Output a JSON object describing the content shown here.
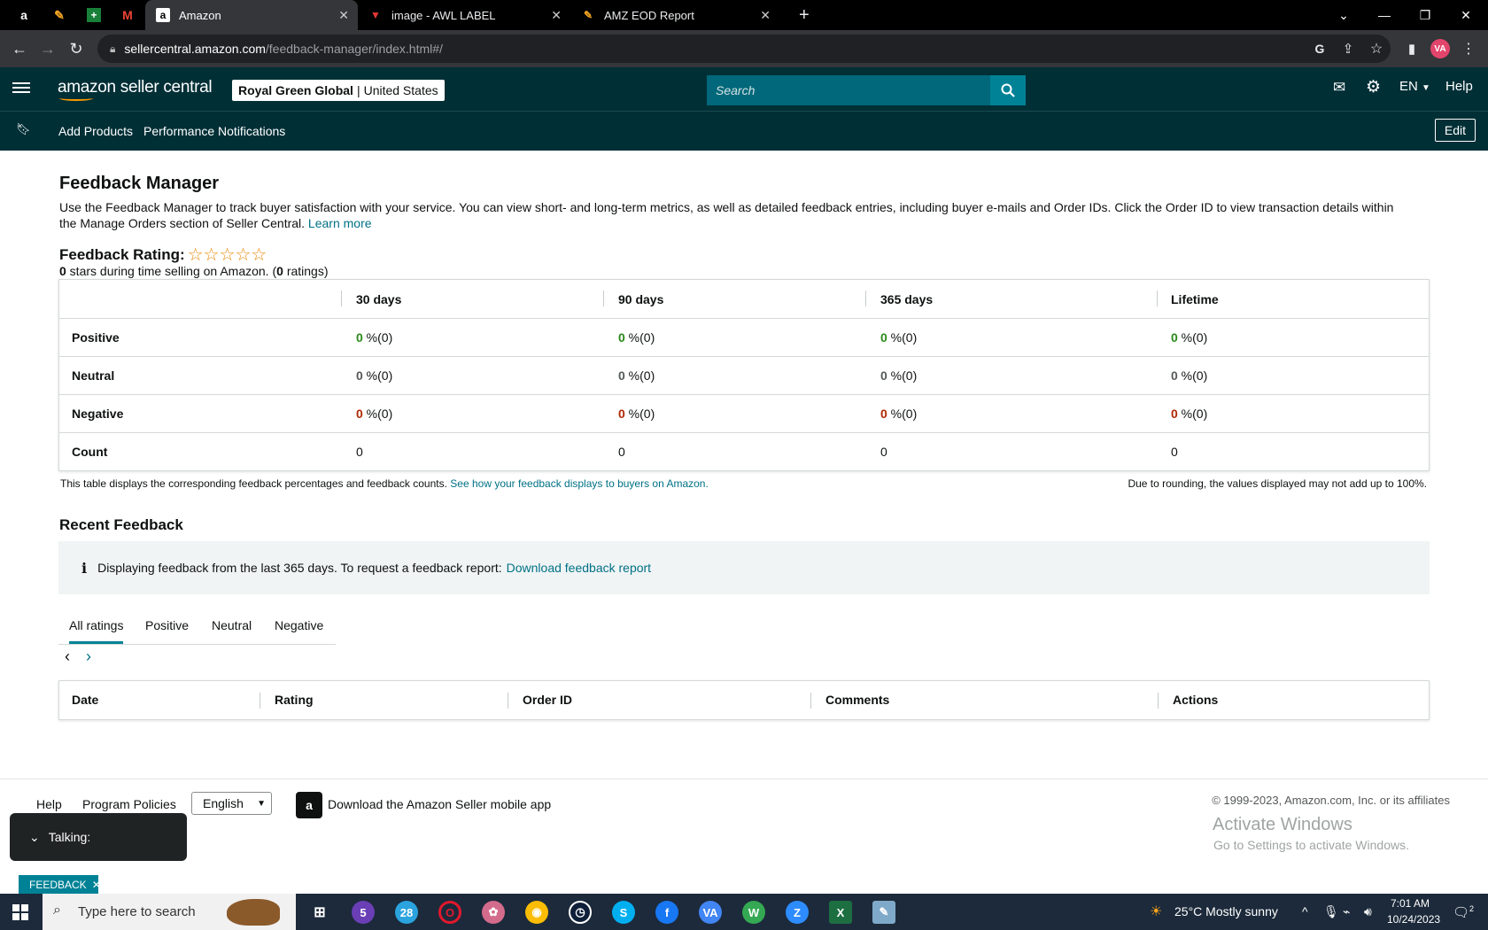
{
  "browser": {
    "tabs": [
      {
        "title": "Amazon",
        "favicon": "amazon-icon"
      },
      {
        "title": "image - AWL LABEL",
        "favicon": "awl-icon"
      },
      {
        "title": "AMZ EOD Report",
        "favicon": "zoho-icon"
      }
    ],
    "url_host": "sellercentral.amazon.com",
    "url_path": "/feedback-manager/index.html#/"
  },
  "header": {
    "logo_text": "amazon seller central",
    "account_store": "Royal Green Global",
    "account_separator": "|",
    "account_region": "United States",
    "search_placeholder": "Search",
    "language": "EN",
    "help": "Help"
  },
  "nav": {
    "items": [
      "Add Products",
      "Performance Notifications"
    ],
    "edit": "Edit"
  },
  "page": {
    "title": "Feedback Manager",
    "intro": "Use the Feedback Manager to track buyer satisfaction with your service. You can view short- and long-term metrics, as well as detailed feedback entries, including buyer e-mails and Order IDs. Click the Order ID to view transaction details within the Manage Orders section of Seller Central.",
    "learn_more": "Learn more",
    "rating_label": "Feedback Rating:",
    "stars_text": "☆☆☆☆☆",
    "stars_value": "0",
    "stars_suffix": " stars during time selling on Amazon. (",
    "ratings_count": "0",
    "ratings_suffix": " ratings)"
  },
  "metrics": {
    "columns": [
      "30 days",
      "90 days",
      "365 days",
      "Lifetime"
    ],
    "rows": [
      {
        "label": "Positive",
        "values": [
          "0",
          "0",
          "0",
          "0"
        ],
        "suffix": " %(0)"
      },
      {
        "label": "Neutral",
        "values": [
          "0",
          "0",
          "0",
          "0"
        ],
        "suffix": " %(0)"
      },
      {
        "label": "Negative",
        "values": [
          "0",
          "0",
          "0",
          "0"
        ],
        "suffix": " %(0)"
      },
      {
        "label": "Count",
        "values": [
          "0",
          "0",
          "0",
          "0"
        ],
        "suffix": ""
      }
    ],
    "note": "This table displays the corresponding feedback percentages and feedback counts.",
    "note_link": "See how your feedback displays to buyers on Amazon.",
    "rounding_note": "Due to rounding, the values displayed may not add up to 100%."
  },
  "recent": {
    "title": "Recent Feedback",
    "info_text": "Displaying feedback from the last 365 days. To request a feedback report:",
    "info_link": "Download feedback report",
    "tabs": [
      "All ratings",
      "Positive",
      "Neutral",
      "Negative"
    ],
    "table_headers": [
      "Date",
      "Rating",
      "Order ID",
      "Comments",
      "Actions"
    ]
  },
  "footer": {
    "help": "Help",
    "program_policies": "Program Policies",
    "language_selected": "English",
    "app_text": "Download the Amazon Seller mobile app",
    "copyright": "© 1999-2023, Amazon.com, Inc. or its affiliates",
    "activate_title": "Activate Windows",
    "activate_sub": "Go to Settings to activate Windows."
  },
  "overlay": {
    "talking": "Talking:",
    "feedback_badge": "FEEDBACK"
  },
  "taskbar": {
    "search_placeholder": "Type here to search",
    "weather": "25°C  Mostly sunny",
    "time": "7:01 AM",
    "date": "10/24/2023",
    "badges": {
      "app1": "5",
      "app2": "28",
      "notif": "2"
    }
  },
  "colors": {
    "header_bg": "#002f36",
    "accent": "#008296",
    "link": "#007185",
    "positive": "#2a8a19",
    "negative": "#b12704"
  }
}
